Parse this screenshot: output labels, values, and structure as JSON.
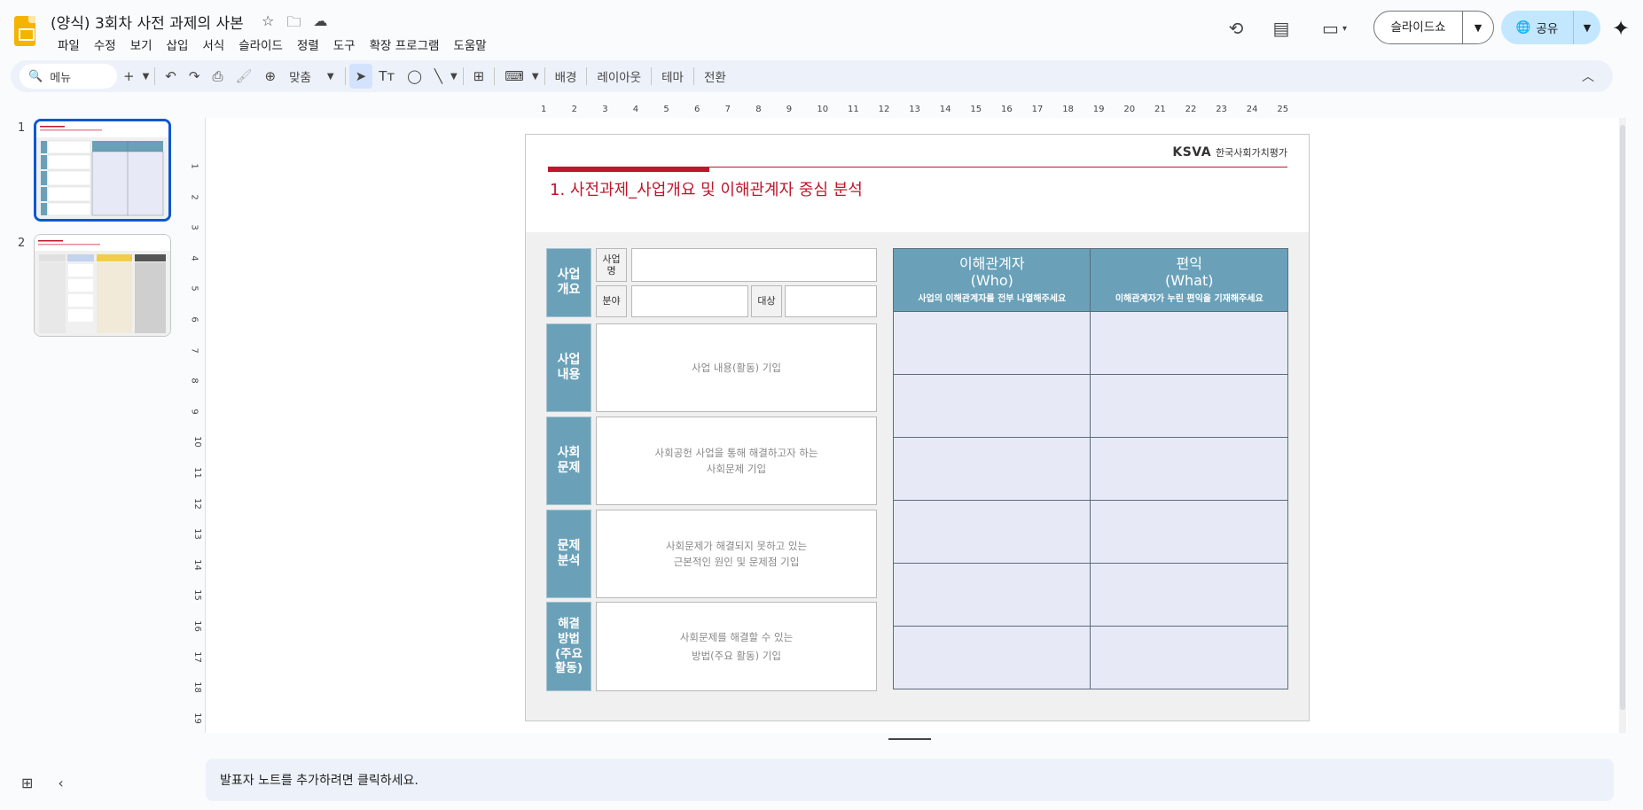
{
  "header": {
    "doc_title": "(양식) 3회차 사전 과제의 사본",
    "menu": [
      "파일",
      "수정",
      "보기",
      "삽입",
      "서식",
      "슬라이드",
      "정렬",
      "도구",
      "확장 프로그램",
      "도움말"
    ],
    "slideshow_label": "슬라이드쇼",
    "share_label": "공유"
  },
  "toolbar": {
    "search_label": "메뉴",
    "zoom_label": "맞춤",
    "background_label": "배경",
    "layout_label": "레이아웃",
    "theme_label": "테마",
    "transition_label": "전환"
  },
  "filmstrip": {
    "slides": [
      {
        "number": "1"
      },
      {
        "number": "2"
      }
    ]
  },
  "ruler": {
    "horizontal": [
      "1",
      "2",
      "3",
      "4",
      "5",
      "6",
      "7",
      "8",
      "9",
      "10",
      "11",
      "12",
      "13",
      "14",
      "15",
      "16",
      "17",
      "18",
      "19",
      "20",
      "21",
      "22",
      "23",
      "24",
      "25"
    ],
    "vertical": [
      "1",
      "2",
      "3",
      "4",
      "5",
      "6",
      "7",
      "8",
      "9",
      "10",
      "11",
      "12",
      "13",
      "14",
      "15",
      "16",
      "17",
      "18",
      "19"
    ]
  },
  "slide": {
    "brand_mark": "KSVA",
    "brand_name": "한국사회가치평가",
    "title": "1. 사전과제_사업개요 및 이해관계자 중심 분석",
    "overview_label": "사업\n개요",
    "name_label": "사업\n명",
    "field_label": "분야",
    "target_label": "대상",
    "rows": [
      {
        "label": "사업\n내용",
        "placeholder": "사업 내용(활동) 기입"
      },
      {
        "label": "사회\n문제",
        "placeholder": "사회공헌 사업을 통해 해결하고자 하는\n사회문제 기입"
      },
      {
        "label": "문제\n분석",
        "placeholder": "사회문제가 해결되지 못하고 있는\n근본적인 원인 및 문제점 기입"
      },
      {
        "label": "해결\n방법\n(주요\n활동)",
        "placeholder": "사회문제를 해결할 수 있는\n방법(주요 활동) 기입"
      }
    ],
    "table": {
      "col1_title": "이해관계자\n(Who)",
      "col1_sub": "사업의 이해관계자를 전부 나열해주세요",
      "col2_title": "편익\n(What)",
      "col2_sub": "이해관계자가 누린 편익을 기재해주세요"
    }
  },
  "notes": {
    "placeholder": "발표자 노트를 추가하려면 클릭하세요."
  },
  "colors": {
    "accent_red": "#c0162c",
    "label_teal": "#6aa1b9",
    "table_cell": "#e7eaf6",
    "share_blue": "#c2e7ff"
  }
}
